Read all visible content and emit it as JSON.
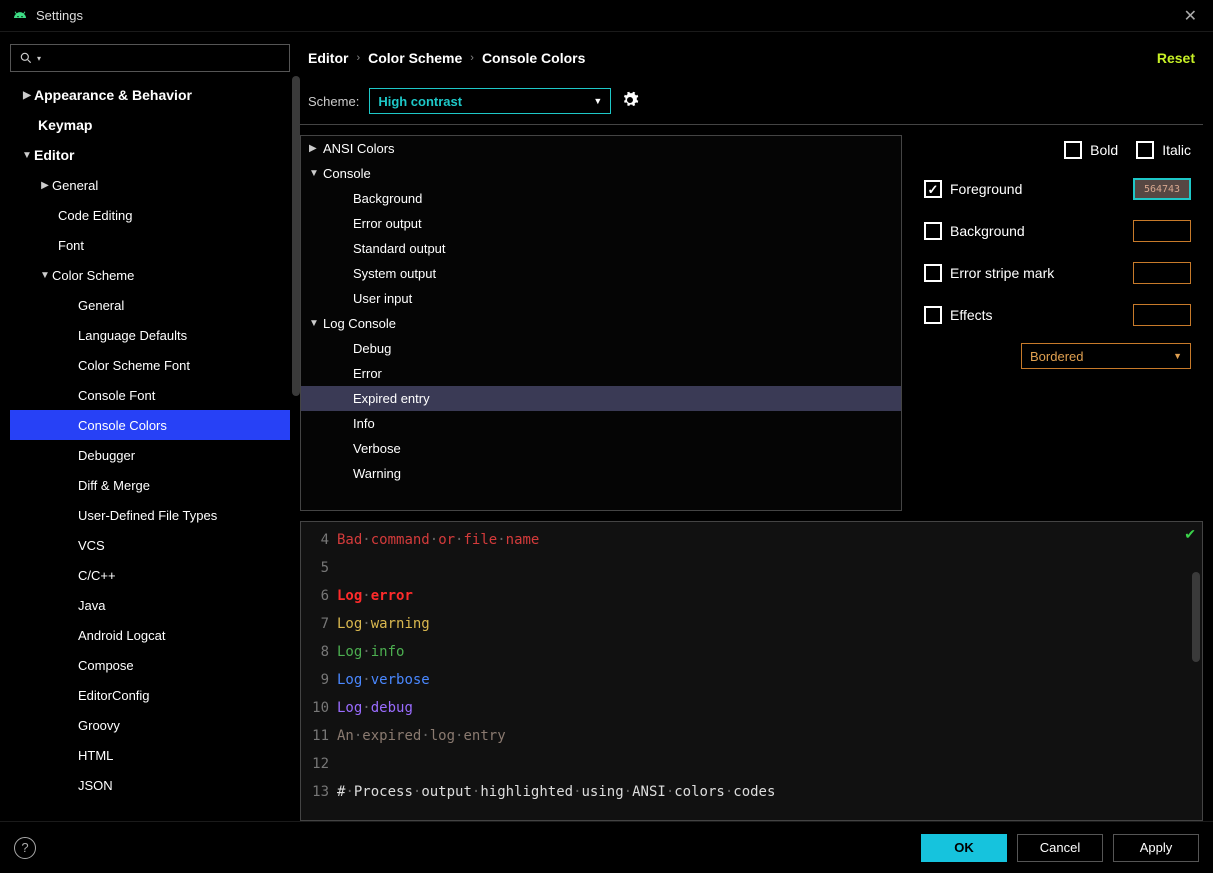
{
  "window": {
    "title": "Settings"
  },
  "breadcrumb": {
    "a": "Editor",
    "b": "Color Scheme",
    "c": "Console Colors",
    "reset": "Reset"
  },
  "scheme": {
    "label": "Scheme:",
    "value": "High contrast"
  },
  "sidebar": {
    "items": [
      {
        "label": "Appearance & Behavior",
        "bold": true,
        "arrow": "▶",
        "pad": 0
      },
      {
        "label": "Keymap",
        "bold": true,
        "arrow": "",
        "pad": 0,
        "padExtra": true
      },
      {
        "label": "Editor",
        "bold": true,
        "arrow": "▼",
        "pad": 0
      },
      {
        "label": "General",
        "arrow": "▶",
        "pad": 1
      },
      {
        "label": "Code Editing",
        "arrow": "",
        "pad": 1,
        "padExtra": true
      },
      {
        "label": "Font",
        "arrow": "",
        "pad": 1,
        "padExtra": true
      },
      {
        "label": "Color Scheme",
        "arrow": "▼",
        "pad": 1
      },
      {
        "label": "General",
        "arrow": "",
        "pad": 3
      },
      {
        "label": "Language Defaults",
        "arrow": "",
        "pad": 3
      },
      {
        "label": "Color Scheme Font",
        "arrow": "",
        "pad": 3
      },
      {
        "label": "Console Font",
        "arrow": "",
        "pad": 3
      },
      {
        "label": "Console Colors",
        "arrow": "",
        "pad": 3,
        "selected": true
      },
      {
        "label": "Debugger",
        "arrow": "",
        "pad": 3
      },
      {
        "label": "Diff & Merge",
        "arrow": "",
        "pad": 3
      },
      {
        "label": "User-Defined File Types",
        "arrow": "",
        "pad": 3
      },
      {
        "label": "VCS",
        "arrow": "",
        "pad": 3
      },
      {
        "label": "C/C++",
        "arrow": "",
        "pad": 3
      },
      {
        "label": "Java",
        "arrow": "",
        "pad": 3
      },
      {
        "label": "Android Logcat",
        "arrow": "",
        "pad": 3
      },
      {
        "label": "Compose",
        "arrow": "",
        "pad": 3
      },
      {
        "label": "EditorConfig",
        "arrow": "",
        "pad": 3
      },
      {
        "label": "Groovy",
        "arrow": "",
        "pad": 3
      },
      {
        "label": "HTML",
        "arrow": "",
        "pad": 3
      },
      {
        "label": "JSON",
        "arrow": "",
        "pad": 3
      }
    ]
  },
  "attrs": [
    {
      "label": "ANSI Colors",
      "arrow": "▶",
      "pad": 1
    },
    {
      "label": "Console",
      "arrow": "▼",
      "pad": 1
    },
    {
      "label": "Background",
      "arrow": "",
      "pad": 3
    },
    {
      "label": "Error output",
      "arrow": "",
      "pad": 3
    },
    {
      "label": "Standard output",
      "arrow": "",
      "pad": 3
    },
    {
      "label": "System output",
      "arrow": "",
      "pad": 3
    },
    {
      "label": "User input",
      "arrow": "",
      "pad": 3
    },
    {
      "label": "Log Console",
      "arrow": "▼",
      "pad": 1
    },
    {
      "label": "Debug",
      "arrow": "",
      "pad": 3
    },
    {
      "label": "Error",
      "arrow": "",
      "pad": 3
    },
    {
      "label": "Expired entry",
      "arrow": "",
      "pad": 3,
      "selected": true
    },
    {
      "label": "Info",
      "arrow": "",
      "pad": 3
    },
    {
      "label": "Verbose",
      "arrow": "",
      "pad": 3
    },
    {
      "label": "Warning",
      "arrow": "",
      "pad": 3
    }
  ],
  "props": {
    "bold": "Bold",
    "italic": "Italic",
    "foreground": "Foreground",
    "foreground_hex": "564743",
    "background": "Background",
    "error_stripe": "Error stripe mark",
    "effects": "Effects",
    "effects_type": "Bordered"
  },
  "preview": {
    "lines": [
      {
        "n": "4",
        "tokens": [
          {
            "t": "Bad",
            "c": "c-red"
          },
          {
            "t": "·",
            "c": "dot"
          },
          {
            "t": "command",
            "c": "c-red"
          },
          {
            "t": "·",
            "c": "dot"
          },
          {
            "t": "or",
            "c": "c-red"
          },
          {
            "t": "·",
            "c": "dot"
          },
          {
            "t": "file",
            "c": "c-red"
          },
          {
            "t": "·",
            "c": "dot"
          },
          {
            "t": "name",
            "c": "c-red"
          }
        ]
      },
      {
        "n": "5",
        "tokens": []
      },
      {
        "n": "6",
        "tokens": [
          {
            "t": "Log",
            "c": "c-redB"
          },
          {
            "t": "·",
            "c": "dot"
          },
          {
            "t": "error",
            "c": "c-redB"
          }
        ]
      },
      {
        "n": "7",
        "tokens": [
          {
            "t": "Log",
            "c": "c-yellow"
          },
          {
            "t": "·",
            "c": "dot"
          },
          {
            "t": "warning",
            "c": "c-yellow"
          }
        ]
      },
      {
        "n": "8",
        "tokens": [
          {
            "t": "Log",
            "c": "c-green"
          },
          {
            "t": "·",
            "c": "dot"
          },
          {
            "t": "info",
            "c": "c-green"
          }
        ]
      },
      {
        "n": "9",
        "tokens": [
          {
            "t": "Log",
            "c": "c-blue"
          },
          {
            "t": "·",
            "c": "dot"
          },
          {
            "t": "verbose",
            "c": "c-blue"
          }
        ]
      },
      {
        "n": "10",
        "tokens": [
          {
            "t": "Log",
            "c": "c-purple"
          },
          {
            "t": "·",
            "c": "dot"
          },
          {
            "t": "debug",
            "c": "c-purple"
          }
        ]
      },
      {
        "n": "11",
        "tokens": [
          {
            "t": "An",
            "c": "c-grey2"
          },
          {
            "t": "·",
            "c": "dot"
          },
          {
            "t": "expired",
            "c": "c-grey2"
          },
          {
            "t": "·",
            "c": "dot"
          },
          {
            "t": "log",
            "c": "c-grey2"
          },
          {
            "t": "·",
            "c": "dot"
          },
          {
            "t": "entry",
            "c": "c-grey2"
          }
        ]
      },
      {
        "n": "12",
        "tokens": []
      },
      {
        "n": "13",
        "tokens": [
          {
            "t": "#",
            "c": "c-white"
          },
          {
            "t": "·",
            "c": "dot"
          },
          {
            "t": "Process",
            "c": "c-white"
          },
          {
            "t": "·",
            "c": "dot"
          },
          {
            "t": "output",
            "c": "c-white"
          },
          {
            "t": "·",
            "c": "dot"
          },
          {
            "t": "highlighted",
            "c": "c-white"
          },
          {
            "t": "·",
            "c": "dot"
          },
          {
            "t": "using",
            "c": "c-white"
          },
          {
            "t": "·",
            "c": "dot"
          },
          {
            "t": "ANSI",
            "c": "c-white"
          },
          {
            "t": "·",
            "c": "dot"
          },
          {
            "t": "colors",
            "c": "c-white"
          },
          {
            "t": "·",
            "c": "dot"
          },
          {
            "t": "codes",
            "c": "c-white"
          }
        ]
      }
    ]
  },
  "footer": {
    "ok": "OK",
    "cancel": "Cancel",
    "apply": "Apply"
  }
}
